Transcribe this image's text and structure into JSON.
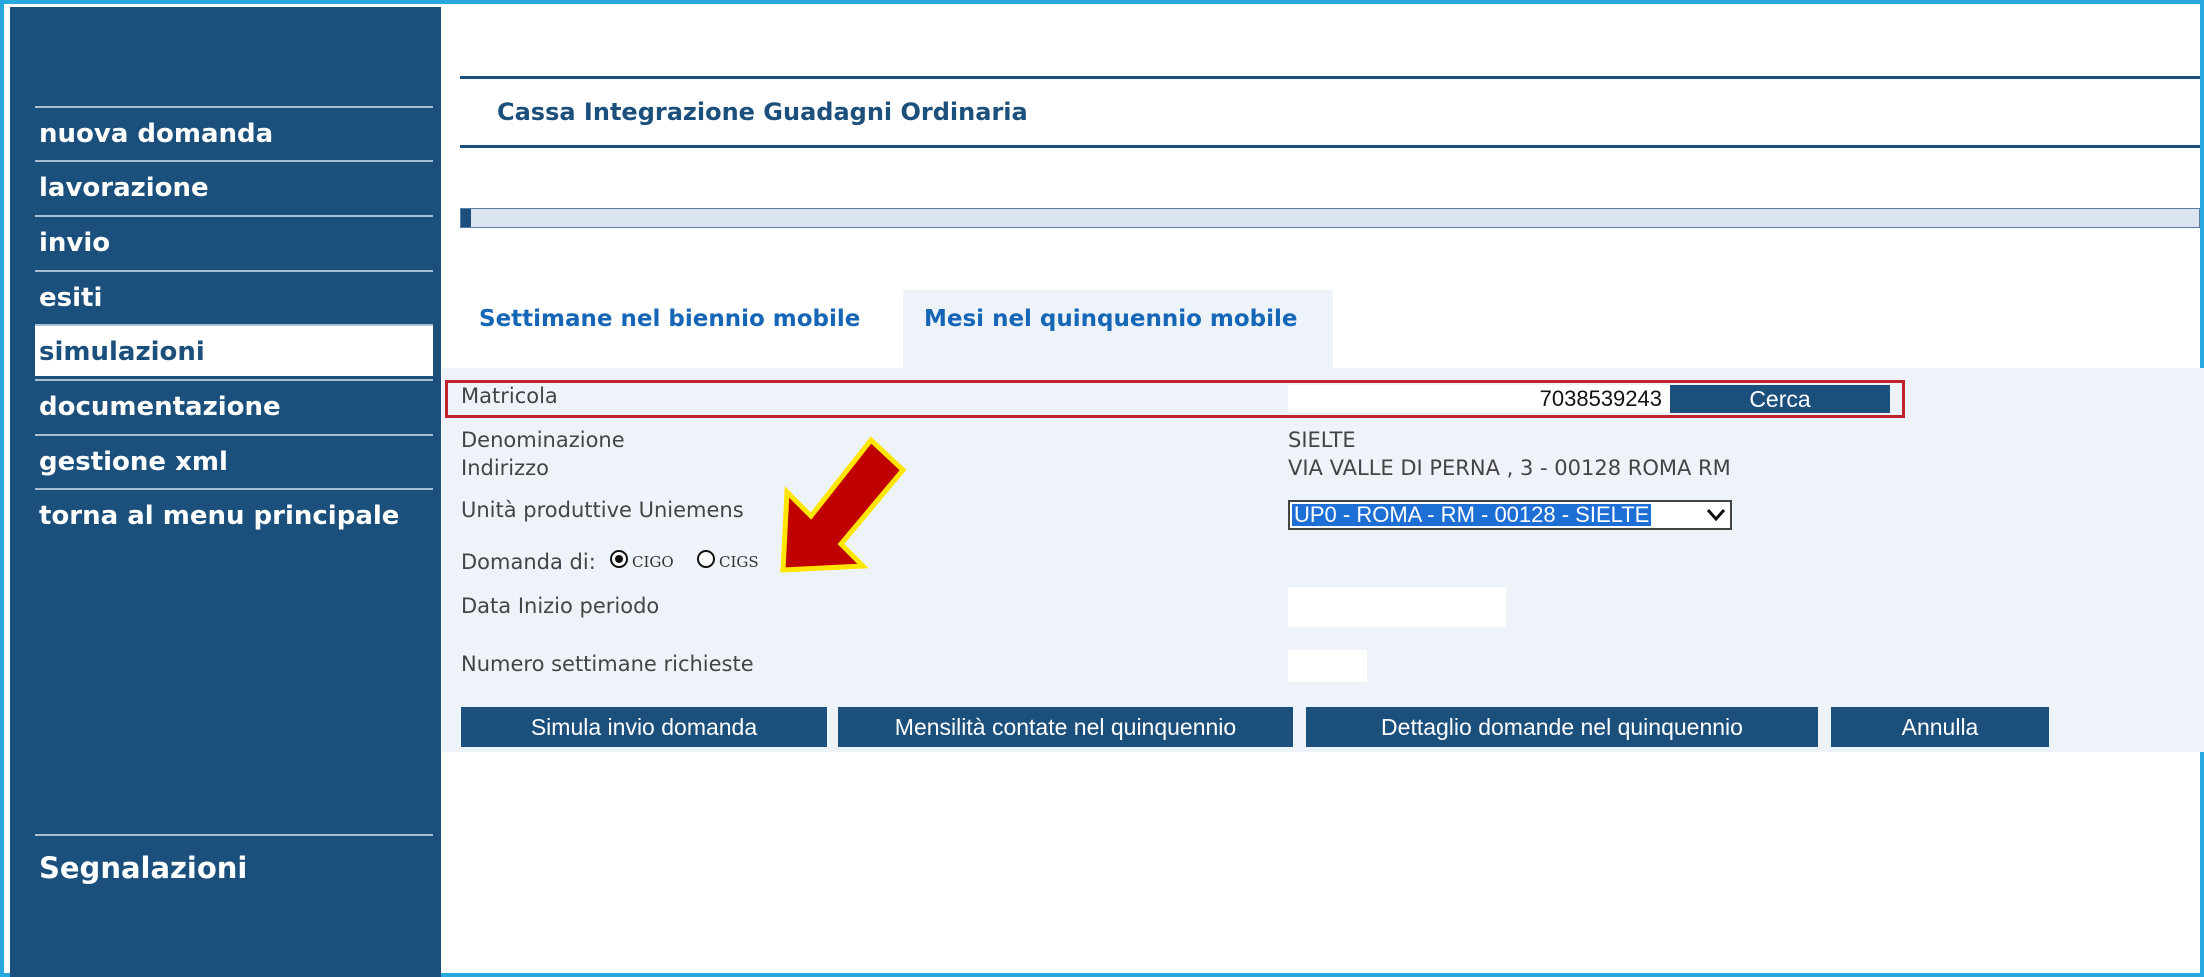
{
  "sidebar": {
    "items": [
      {
        "label": "nuova domanda"
      },
      {
        "label": "lavorazione"
      },
      {
        "label": "invio"
      },
      {
        "label": "esiti"
      },
      {
        "label": "simulazioni",
        "active": true
      },
      {
        "label": "documentazione"
      },
      {
        "label": "gestione xml"
      },
      {
        "label": "torna al menu principale"
      }
    ],
    "footer_label": "Segnalazioni"
  },
  "header": {
    "title": "Cassa Integrazione Guadagni Ordinaria"
  },
  "tabs": [
    {
      "label": "Settimane nel biennio mobile",
      "active": false
    },
    {
      "label": "Mesi nel quinquennio mobile",
      "active": true
    }
  ],
  "form": {
    "matricola": {
      "label": "Matricola",
      "value": "7038539243",
      "search_button": "Cerca"
    },
    "denominazione": {
      "label": "Denominazione",
      "value": "SIELTE"
    },
    "indirizzo": {
      "label": "Indirizzo",
      "value": "VIA VALLE DI PERNA , 3 - 00128 ROMA RM"
    },
    "unita": {
      "label": "Unità produttive Uniemens",
      "selected": "UP0 - ROMA - RM - 00128 - SIELTE"
    },
    "domanda": {
      "label": "Domanda di:",
      "options": [
        "CIGO",
        "CIGS"
      ],
      "selected": "CIGO"
    },
    "data_inizio": {
      "label": "Data Inizio periodo",
      "value": ""
    },
    "numero_settimane": {
      "label": "Numero settimane richieste",
      "value": ""
    }
  },
  "actions": {
    "simula": "Simula invio domanda",
    "mensilita": "Mensilità contate nel quinquennio",
    "dettaglio": "Dettaglio domande nel quinquennio",
    "annulla": "Annulla"
  },
  "colors": {
    "sidebar_bg": "#1b4f7c",
    "accent": "#1566b7",
    "highlight_box": "#c0232e",
    "annotation_arrow": "#c00000",
    "arrow_outline": "#ffe600"
  }
}
